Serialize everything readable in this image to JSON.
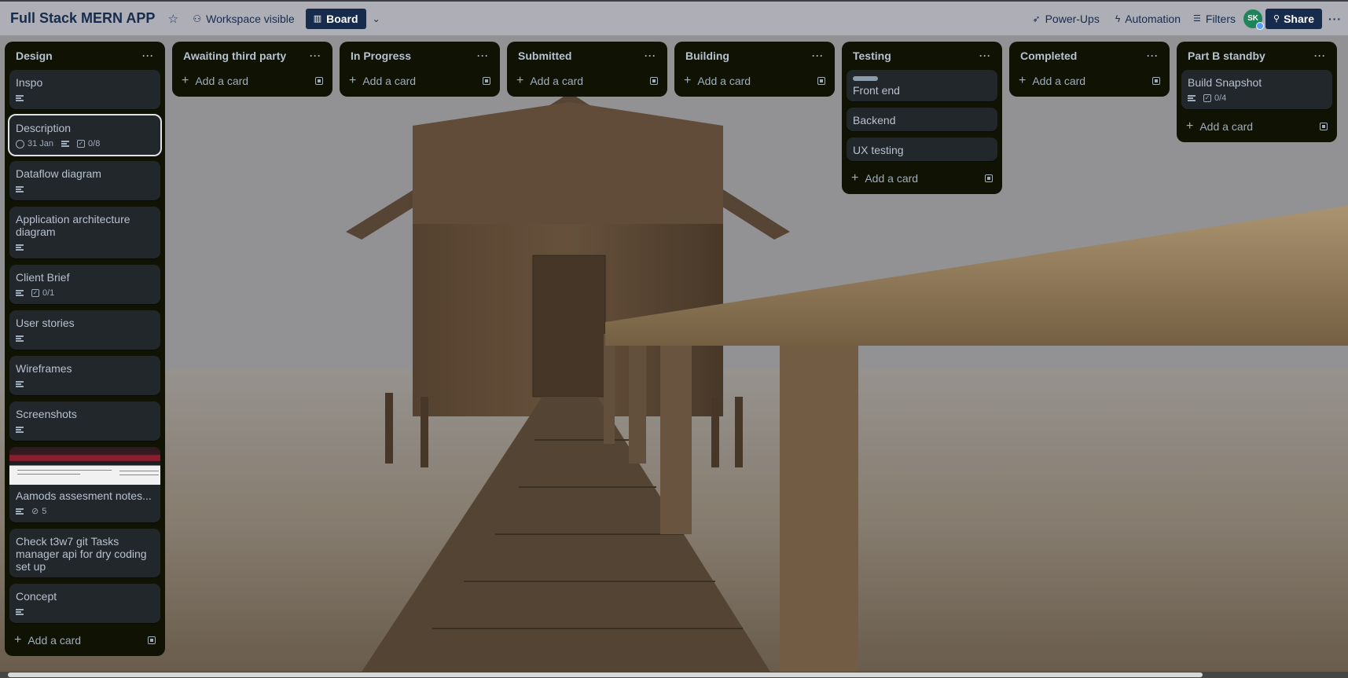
{
  "header": {
    "board_title": "Full Stack MERN APP",
    "visibility_label": "Workspace visible",
    "view_label": "Board",
    "powerups_label": "Power-Ups",
    "automation_label": "Automation",
    "filters_label": "Filters",
    "avatar_initials": "SK",
    "share_label": "Share"
  },
  "lists": [
    {
      "title": "Design",
      "add_label": "Add a card",
      "cards": [
        {
          "title": "Inspo"
        },
        {
          "title": "Description",
          "date": "31 Jan",
          "checklist": "0/8"
        },
        {
          "title": "Dataflow diagram"
        },
        {
          "title": "Application architecture diagram"
        },
        {
          "title": "Client Brief",
          "checklist": "0/1"
        },
        {
          "title": "User stories"
        },
        {
          "title": "Wireframes"
        },
        {
          "title": "Screenshots"
        },
        {
          "title": "Aamods assesment notes...",
          "attachments": "5"
        },
        {
          "title": "Check t3w7 git Tasks manager api for dry coding set up"
        },
        {
          "title": "Concept"
        }
      ]
    },
    {
      "title": "Awaiting third party",
      "add_label": "Add a card"
    },
    {
      "title": "In Progress",
      "add_label": "Add a card"
    },
    {
      "title": "Submitted",
      "add_label": "Add a card"
    },
    {
      "title": "Building",
      "add_label": "Add a card"
    },
    {
      "title": "Testing",
      "add_label": "Add a card",
      "cards": [
        {
          "title": "Front end"
        },
        {
          "title": "Backend"
        },
        {
          "title": "UX testing"
        }
      ]
    },
    {
      "title": "Completed",
      "add_label": "Add a card"
    },
    {
      "title": "Part B standby",
      "add_label": "Add a card",
      "cards": [
        {
          "title": "Build Snapshot",
          "checklist": "0/4"
        }
      ]
    }
  ],
  "icons": {
    "star": "star-icon",
    "visibility": "people-icon",
    "board": "board-icon",
    "powerups": "rocket-icon",
    "automation": "lightning-icon",
    "filters": "filter-icon"
  }
}
